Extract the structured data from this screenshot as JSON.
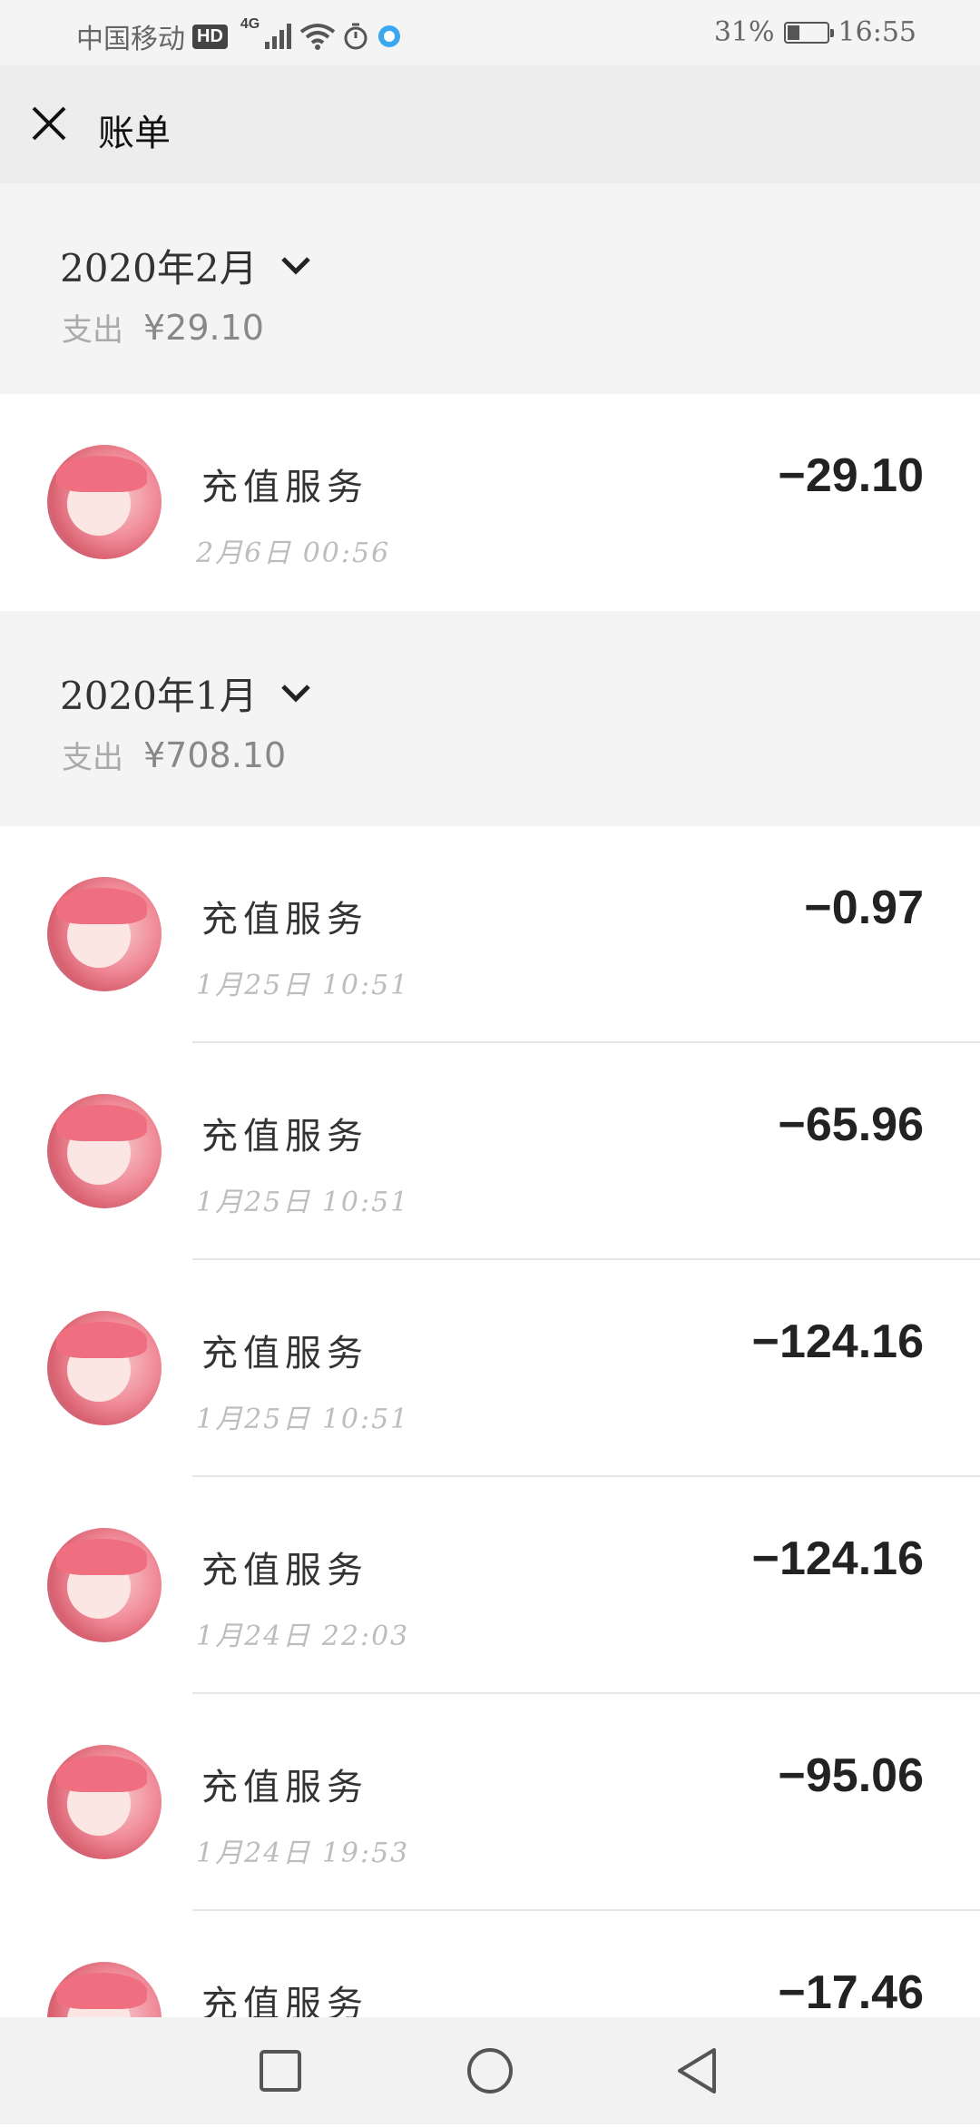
{
  "status_bar": {
    "carrier": "中国移动",
    "hd": "HD",
    "network": "4G",
    "battery": "31%",
    "battery_level": 0.31,
    "time": "16:55"
  },
  "header": {
    "title": "账单"
  },
  "months": [
    {
      "title": "2020年2月",
      "spend_label": "支出",
      "spend_amount": "¥29.10",
      "transactions": [
        {
          "desc": "充值服务",
          "time": "2月6日 00:56",
          "amount": "−29.10"
        }
      ]
    },
    {
      "title": "2020年1月",
      "spend_label": "支出",
      "spend_amount": "¥708.10",
      "transactions": [
        {
          "desc": "充值服务",
          "time": "1月25日 10:51",
          "amount": "−0.97"
        },
        {
          "desc": "充值服务",
          "time": "1月25日 10:51",
          "amount": "−65.96"
        },
        {
          "desc": "充值服务",
          "time": "1月25日 10:51",
          "amount": "−124.16"
        },
        {
          "desc": "充值服务",
          "time": "1月24日 22:03",
          "amount": "−124.16"
        },
        {
          "desc": "充值服务",
          "time": "1月24日 19:53",
          "amount": "−95.06"
        },
        {
          "desc": "充值服务",
          "time": "",
          "amount": "−17.46"
        }
      ]
    }
  ],
  "icons": {
    "close": "close-icon",
    "chevron": "chevron-down-icon",
    "nav_recent": "square-icon",
    "nav_home": "circle-icon",
    "nav_back": "triangle-back-icon"
  }
}
